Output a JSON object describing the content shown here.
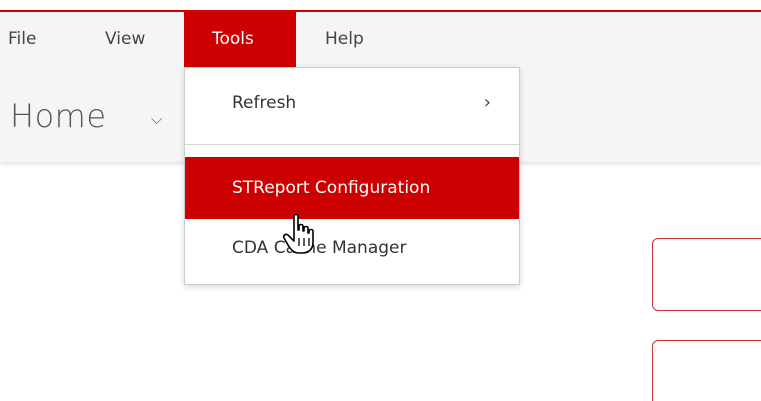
{
  "menubar": {
    "items": [
      {
        "label": "File"
      },
      {
        "label": "View"
      },
      {
        "label": "Tools"
      },
      {
        "label": "Help"
      }
    ],
    "active": "Tools"
  },
  "header": {
    "title": "Home"
  },
  "tools_menu": {
    "items": [
      {
        "label": "Refresh",
        "has_submenu": true
      },
      {
        "label": "STReport Configuration",
        "highlighted": true
      },
      {
        "label": "CDA Cache Manager"
      }
    ]
  },
  "colors": {
    "accent": "#cc0000",
    "header_bg": "#f5f5f5",
    "text": "#333333"
  },
  "icons": {
    "home_dropdown": "chevron-down-icon",
    "refresh_submenu": "chevron-right-icon",
    "cursor": "hand-pointer-icon"
  }
}
